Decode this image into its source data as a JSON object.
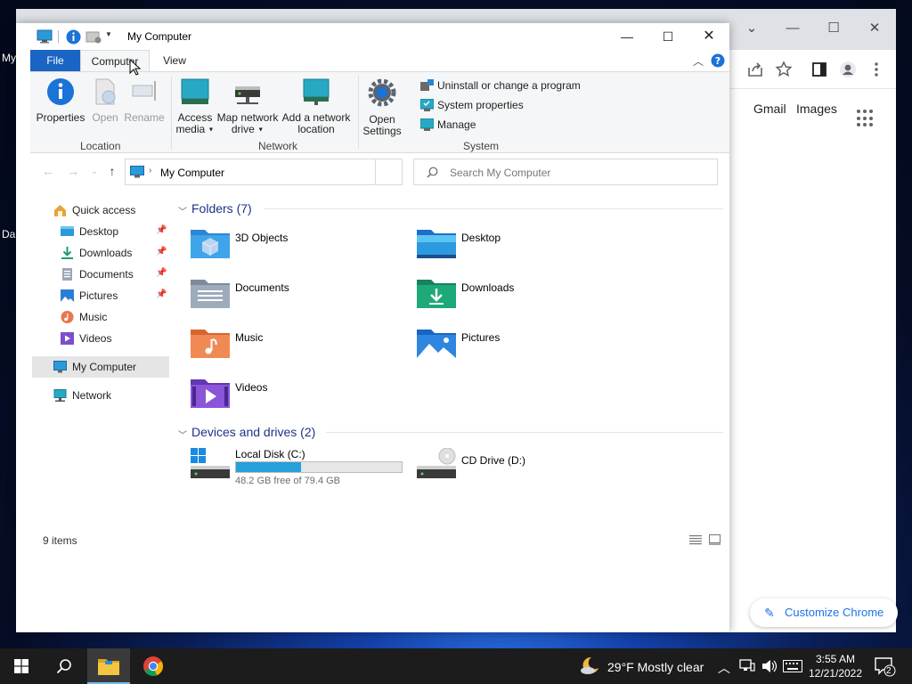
{
  "desktop": {
    "label_top": "My",
    "label_bottom": "Da"
  },
  "chrome": {
    "gmail": "Gmail",
    "images": "Images",
    "customize": "Customize Chrome",
    "controls": {
      "tabs_down": "⌄",
      "minimize": "—",
      "maximize": "☐",
      "close": "✕"
    }
  },
  "explorer": {
    "title": "My Computer",
    "tabs": {
      "file": "File",
      "computer": "Computer",
      "view": "View"
    },
    "ribbon": {
      "location": {
        "label": "Location",
        "properties": "Properties",
        "open": "Open",
        "rename": "Rename"
      },
      "network": {
        "label": "Network",
        "access_media_1": "Access",
        "access_media_2": "media",
        "map_drive_1": "Map network",
        "map_drive_2": "drive",
        "add_location_1": "Add a network",
        "add_location_2": "location"
      },
      "system": {
        "label": "System",
        "open_settings_1": "Open",
        "open_settings_2": "Settings",
        "uninstall": "Uninstall or change a program",
        "system_properties": "System properties",
        "manage": "Manage"
      }
    },
    "address": "My Computer",
    "search_placeholder": "Search My Computer",
    "nav": {
      "quick_access": "Quick access",
      "items": [
        "Desktop",
        "Downloads",
        "Documents",
        "Pictures",
        "Music",
        "Videos"
      ],
      "my_computer": "My Computer",
      "network": "Network"
    },
    "folders_header": "Folders (7)",
    "folders": [
      "3D Objects",
      "Desktop",
      "Documents",
      "Downloads",
      "Music",
      "Pictures",
      "Videos"
    ],
    "devices_header": "Devices and drives (2)",
    "drives": {
      "c_name": "Local Disk (C:)",
      "c_free": "48.2 GB free of 79.4 GB",
      "c_used_fraction": 0.393,
      "d_name": "CD Drive (D:)"
    },
    "status": "9 items"
  },
  "taskbar": {
    "weather": "29°F  Mostly clear",
    "time": "3:55 AM",
    "date": "12/21/2022",
    "notifications": "2"
  },
  "colors": {
    "ribbon_file_tab": "#1a64c3",
    "group_header": "#1e3287",
    "drive_fill": "#26a0da",
    "chrome_accent": "#1a73e8"
  }
}
